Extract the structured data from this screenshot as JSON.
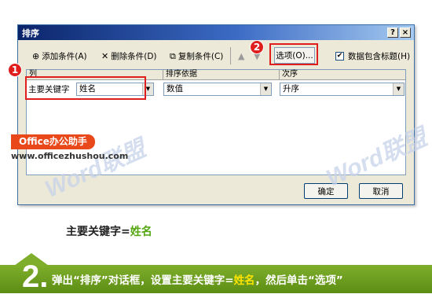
{
  "dialog": {
    "title": "排序",
    "help_btn": "?",
    "close_btn": "×",
    "toolbar": {
      "add_label": "添加条件(A)",
      "delete_label": "删除条件(D)",
      "copy_label": "复制条件(C)",
      "options_label": "选项(O)...",
      "header_check_label": "数据包含标题(H)",
      "header_checked": true
    },
    "grid": {
      "col_header": "列",
      "sort_on_header": "排序依据",
      "order_header": "次序",
      "row_label": "主要关键字",
      "key_value": "姓名",
      "sort_on_value": "数值",
      "order_value": "升序"
    },
    "ok_label": "确定",
    "cancel_label": "取消"
  },
  "annotations": {
    "badge1": "1",
    "badge2": "2",
    "highlight_color": "#e01e1e"
  },
  "brand": {
    "name": "Office办公助手",
    "url": "www.officezhushou.com",
    "watermark": "Word联盟"
  },
  "caption": {
    "prefix": "主要关键字=",
    "value": "姓名"
  },
  "step": {
    "number": "2.",
    "text_a": "弹出“排序”对话框，设置主要关键字=",
    "text_highlight": "姓名",
    "text_b": "，然后单击“选项”"
  },
  "colors": {
    "accent_green": "#54a610",
    "bar_green": "#6f9f21",
    "brand_orange": "#e8481a",
    "highlight_yellow": "#ffe400"
  }
}
